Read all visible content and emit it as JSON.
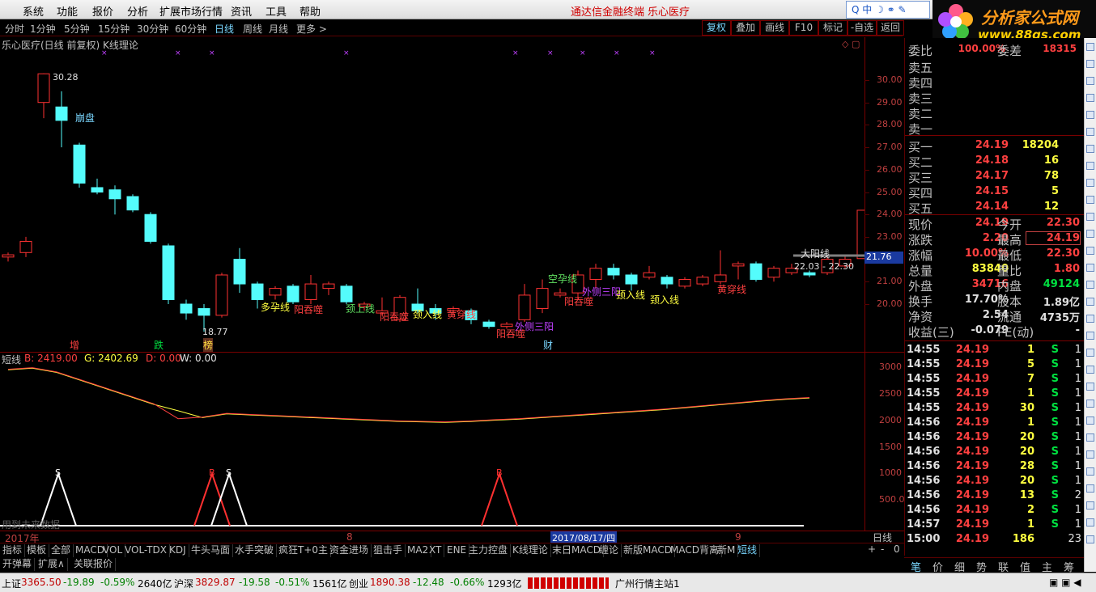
{
  "menu": {
    "items": [
      "系统",
      "功能",
      "报价",
      "分析",
      "扩展市场行情",
      "资讯",
      "工具",
      "帮助"
    ],
    "brand": "通达信金融终端",
    "stock_name": "乐心医疗"
  },
  "search": {
    "text": "Q 中 ☽ ⚭ ✎"
  },
  "logo": {
    "title": "分析家公式网",
    "url": "www.88gs.com"
  },
  "periods": [
    "分时",
    "1分钟",
    "5分钟",
    "15分钟",
    "30分钟",
    "60分钟",
    "日线",
    "周线",
    "月线",
    "更多 >"
  ],
  "toolbar": [
    "复权",
    "叠加",
    "画线",
    "F10",
    "标记",
    "-自选",
    "返回"
  ],
  "chart": {
    "title": "乐心医疗(日线 前复权) K线理论",
    "high_label": "30.28",
    "low_label": "18.77",
    "range_label": "22.03 - 22.30",
    "current_price_tag": "21.76",
    "y_ticks": [
      "30.00",
      "29.00",
      "28.00",
      "27.00",
      "26.00",
      "25.00",
      "24.00",
      "23.00",
      "22.00",
      "21.00",
      "20.00"
    ],
    "pattern_labels": [
      "崩盘",
      "多孕线",
      "阳吞噬",
      "颈上线",
      "阳吞噬",
      "颈入线",
      "黄穿线",
      "阳吞噬",
      "外侧三阳",
      "空孕线",
      "外侧三阳",
      "阳吞噬",
      "颈入线",
      "颈入线",
      "黄穿线",
      "大阳线"
    ],
    "bottom_markers": [
      "增",
      "跌",
      "榜",
      "财"
    ]
  },
  "indicator": {
    "name": "短线",
    "b_label": "B: 2419.00",
    "g_label": "G: 2402.69",
    "d_label": "D: 0.00",
    "w_label": "W: 0.00",
    "y_ticks": [
      "3000",
      "2500",
      "2000",
      "1500",
      "1000",
      "500.0"
    ],
    "note": "用到未来数据",
    "s_marks": [
      "S",
      "S"
    ],
    "b_marks": [
      "B",
      "B"
    ]
  },
  "xaxis": {
    "year": "2017年",
    "m8": "8",
    "date": "2017/08/17/四",
    "m9": "9",
    "period": "日线"
  },
  "tabs": [
    "指标",
    "模板",
    "全部",
    "MACD",
    "VOL",
    "VOL-TDX",
    "KDJ",
    "牛头马面",
    "水手突破",
    "疯狂T+0主",
    "资金进场",
    "狙击手",
    "MA2",
    "XT",
    "ENE",
    "主力控盘",
    "K线理论",
    "末日MACD",
    "缠论",
    "新版MACD",
    "MACD背离",
    "新M",
    "短线"
  ],
  "tabs2": [
    "开弹幕",
    "扩展∧",
    "关联报价"
  ],
  "quote": {
    "wb_label": "委比",
    "wb": "100.00%",
    "wc_label": "委差",
    "wc": "18315",
    "sell": [
      {
        "l": "卖五"
      },
      {
        "l": "卖四"
      },
      {
        "l": "卖三"
      },
      {
        "l": "卖二"
      },
      {
        "l": "卖一"
      }
    ],
    "buy": [
      {
        "l": "买一",
        "p": "24.19",
        "v": "18204"
      },
      {
        "l": "买二",
        "p": "24.18",
        "v": "16"
      },
      {
        "l": "买三",
        "p": "24.17",
        "v": "78"
      },
      {
        "l": "买四",
        "p": "24.15",
        "v": "5"
      },
      {
        "l": "买五",
        "p": "24.14",
        "v": "12"
      }
    ],
    "stats": [
      {
        "l": "现价",
        "v": "24.19",
        "l2": "今开",
        "v2": "22.30"
      },
      {
        "l": "涨跌",
        "v": "2.20",
        "l2": "最高",
        "v2": "24.19"
      },
      {
        "l": "涨幅",
        "v": "10.00%",
        "l2": "最低",
        "v2": "22.30"
      },
      {
        "l": "总量",
        "v": "83840",
        "l2": "量比",
        "v2": "1.80"
      },
      {
        "l": "外盘",
        "v": "34716",
        "l2": "内盘",
        "v2": "49124"
      },
      {
        "l": "换手",
        "v": "17.70%",
        "l2": "股本",
        "v2": "1.89亿"
      },
      {
        "l": "净资",
        "v": "2.54",
        "l2": "流通",
        "v2": "4735万"
      },
      {
        "l": "收益(三)",
        "v": "-0.079",
        "l2": "PE(动)",
        "v2": "-"
      }
    ]
  },
  "ticks": [
    {
      "t": "14:55",
      "p": "24.19",
      "v": "1",
      "s": "S",
      "n": "1"
    },
    {
      "t": "14:55",
      "p": "24.19",
      "v": "5",
      "s": "S",
      "n": "1"
    },
    {
      "t": "14:55",
      "p": "24.19",
      "v": "7",
      "s": "S",
      "n": "1"
    },
    {
      "t": "14:55",
      "p": "24.19",
      "v": "1",
      "s": "S",
      "n": "1"
    },
    {
      "t": "14:55",
      "p": "24.19",
      "v": "30",
      "s": "S",
      "n": "1"
    },
    {
      "t": "14:56",
      "p": "24.19",
      "v": "1",
      "s": "S",
      "n": "1"
    },
    {
      "t": "14:56",
      "p": "24.19",
      "v": "20",
      "s": "S",
      "n": "1"
    },
    {
      "t": "14:56",
      "p": "24.19",
      "v": "20",
      "s": "S",
      "n": "1"
    },
    {
      "t": "14:56",
      "p": "24.19",
      "v": "28",
      "s": "S",
      "n": "1"
    },
    {
      "t": "14:56",
      "p": "24.19",
      "v": "20",
      "s": "S",
      "n": "1"
    },
    {
      "t": "14:56",
      "p": "24.19",
      "v": "13",
      "s": "S",
      "n": "2"
    },
    {
      "t": "14:56",
      "p": "24.19",
      "v": "2",
      "s": "S",
      "n": "1"
    },
    {
      "t": "14:57",
      "p": "24.19",
      "v": "1",
      "s": "S",
      "n": "1"
    },
    {
      "t": "15:00",
      "p": "24.19",
      "v": "186",
      "s": "",
      "n": "23"
    }
  ],
  "rtabs": [
    "笔",
    "价",
    "细",
    "势",
    "联",
    "值",
    "主",
    "筹"
  ],
  "status": {
    "sh": "上证",
    "sh_v": "3365.50",
    "sh_c": "-19.89",
    "sh_p": "-0.59%",
    "sh_a": "2640亿",
    "sz": "沪深",
    "sz_v": "3829.87",
    "sz_c": "-19.58",
    "sz_p": "-0.51%",
    "sz_a": "1561亿",
    "cy": "创业",
    "cy_v": "1890.38",
    "cy_c": "-12.48",
    "cy_p": "-0.66%",
    "cy_a": "1293亿",
    "server": "广州行情主站1"
  }
}
